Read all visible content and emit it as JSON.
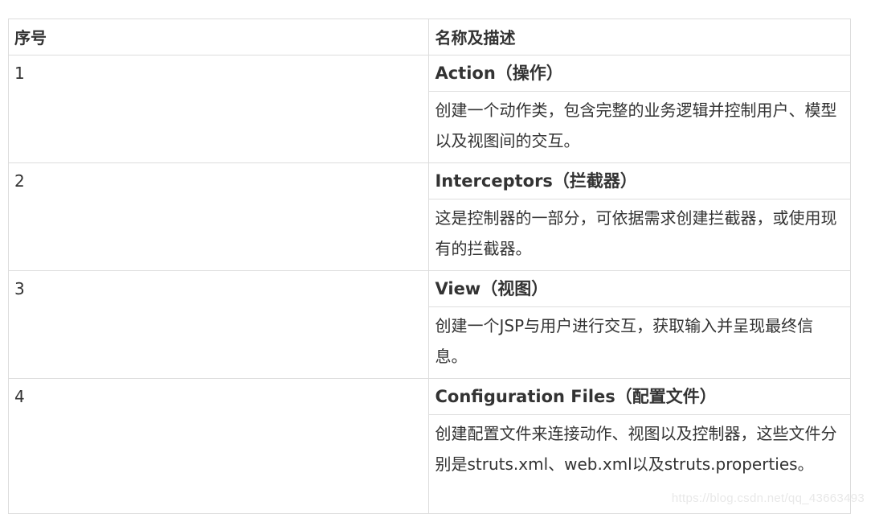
{
  "table": {
    "headers": {
      "num": "序号",
      "desc": "名称及描述"
    },
    "rows": [
      {
        "num": "1",
        "name": "Action（操作）",
        "desc": "创建一个动作类，包含完整的业务逻辑并控制用户、模型以及视图间的交互。"
      },
      {
        "num": "2",
        "name": "Interceptors（拦截器）",
        "desc": "这是控制器的一部分，可依据需求创建拦截器，或使用现有的拦截器。"
      },
      {
        "num": "3",
        "name": "View（视图）",
        "desc": "创建一个JSP与用户进行交互，获取输入并呈现最终信息。"
      },
      {
        "num": "4",
        "name": "Configuration Files（配置文件）",
        "desc": "创建配置文件来连接动作、视图以及控制器，这些文件分别是struts.xml、web.xml以及struts.properties。"
      }
    ]
  },
  "watermark": "https://blog.csdn.net/qq_43663493"
}
